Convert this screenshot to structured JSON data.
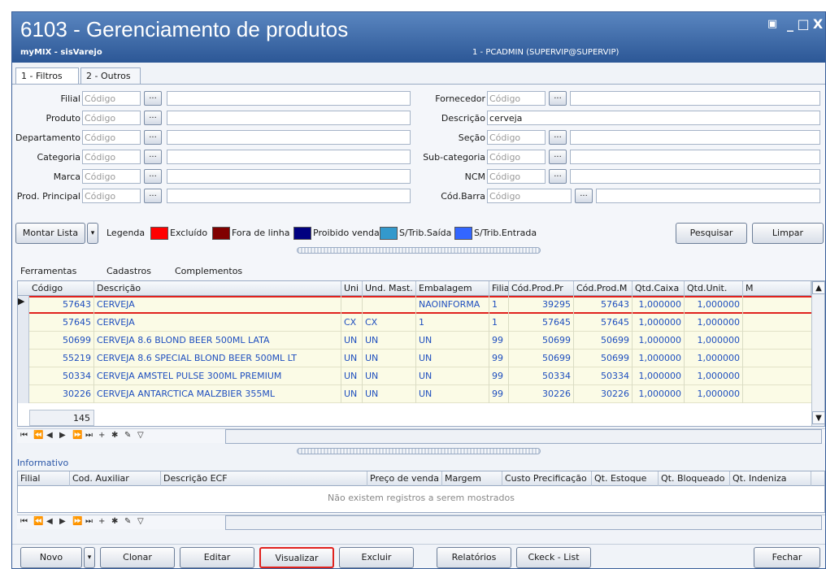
{
  "window": {
    "title": "6103 - Gerenciamento de produtos",
    "subtitle": "myMIX - sisVarejo",
    "user_info": "1 - PCADMIN (SUPERVIP@SUPERVIP)",
    "buttons": {
      "restore": "▣",
      "minimize": "_",
      "maximize": "□",
      "close": "X"
    }
  },
  "tabs": [
    {
      "label": "1 - Filtros",
      "active": true
    },
    {
      "label": "2 - Outros",
      "active": false
    }
  ],
  "filters": {
    "code_placeholder": "Código",
    "browse_label": "...",
    "left": [
      {
        "label": "Filial",
        "value": ""
      },
      {
        "label": "Produto",
        "value": ""
      },
      {
        "label": "Departamento",
        "value": ""
      },
      {
        "label": "Categoria",
        "value": ""
      },
      {
        "label": "Marca",
        "value": ""
      },
      {
        "label": "Prod. Principal",
        "value": ""
      }
    ],
    "right": [
      {
        "label": "Fornecedor",
        "value": ""
      },
      {
        "label": "Descrição",
        "value": "cerveja"
      },
      {
        "label": "Seção",
        "value": ""
      },
      {
        "label": "Sub-categoria",
        "value": ""
      },
      {
        "label": "NCM",
        "value": ""
      },
      {
        "label": "Cód.Barra",
        "value": ""
      }
    ]
  },
  "actions": {
    "montar_lista": "Montar Lista",
    "dropdown": "▾",
    "pesquisar": "Pesquisar",
    "limpar": "Limpar"
  },
  "legend": {
    "title": "Legenda",
    "items": [
      {
        "label": "Excluído",
        "color": "#ff0000"
      },
      {
        "label": "Fora de linha",
        "color": "#800000"
      },
      {
        "label": "Proibido venda",
        "color": "#000080"
      },
      {
        "label": "S/Trib.Saída",
        "color": "#3399cc"
      },
      {
        "label": "S/Trib.Entrada",
        "color": "#3366ff"
      }
    ]
  },
  "menu": [
    "Ferramentas",
    "Cadastros",
    "Complementos"
  ],
  "grid": {
    "columns": [
      "Código",
      "Descrição",
      "Uni",
      "Und. Mast.",
      "Embalagem",
      "Filial",
      "Cód.Prod.Pr",
      "Cód.Prod.M",
      "Qtd.Caixa",
      "Qtd.Unit.",
      "M"
    ],
    "rows": [
      [
        "57643",
        "CERVEJA",
        "",
        "",
        "NAOINFORMA",
        "1",
        "39295",
        "57643",
        "1,000000",
        "1,000000"
      ],
      [
        "57645",
        "CERVEJA",
        "CX",
        "CX",
        "1",
        "1",
        "57645",
        "57645",
        "1,000000",
        "1,000000"
      ],
      [
        "50699",
        "CERVEJA 8.6 BLOND BEER 500ML LATA",
        "UN",
        "UN",
        "UN",
        "99",
        "50699",
        "50699",
        "1,000000",
        "1,000000"
      ],
      [
        "55219",
        "CERVEJA 8.6 SPECIAL BLOND BEER 500ML LT",
        "UN",
        "UN",
        "UN",
        "99",
        "50699",
        "50699",
        "1,000000",
        "1,000000"
      ],
      [
        "50334",
        "CERVEJA AMSTEL PULSE 300ML PREMIUM",
        "UN",
        "UN",
        "UN",
        "99",
        "50334",
        "50334",
        "1,000000",
        "1,000000"
      ],
      [
        "30226",
        "CERVEJA ANTARCTICA MALZBIER 355ML",
        "UN",
        "UN",
        "UN",
        "99",
        "30226",
        "30226",
        "1,000000",
        "1,000000"
      ]
    ],
    "count": "145"
  },
  "info": {
    "title": "Informativo",
    "columns": [
      "Filial",
      "Cod. Auxiliar",
      "Descrição ECF",
      "Preço de venda",
      "Margem",
      "Custo Precificação",
      "Qt. Estoque",
      "Qt. Bloqueado",
      "Qt. Indeniza"
    ],
    "empty": "Não existem registros a serem mostrados"
  },
  "bottom": {
    "novo": "Novo",
    "clonar": "Clonar",
    "editar": "Editar",
    "visualizar": "Visualizar",
    "excluir": "Excluir",
    "relatorios": "Relatórios",
    "checklist": "Ckeck - List",
    "fechar": "Fechar"
  },
  "nav_icons": [
    "⏮",
    "⏪",
    "◀",
    "▶",
    "⏩",
    "⏭",
    "+",
    "✱",
    "✎",
    "▽"
  ]
}
